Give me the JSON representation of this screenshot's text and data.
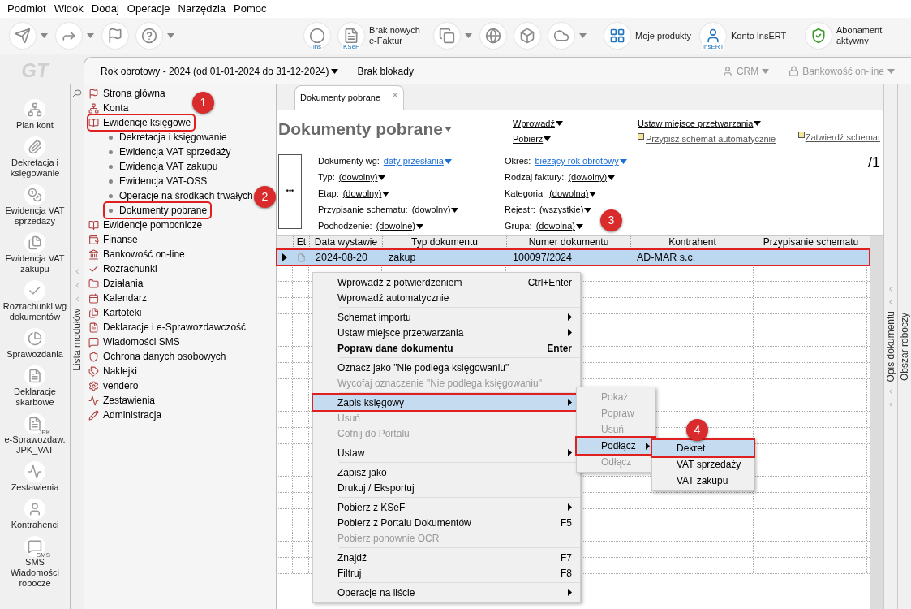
{
  "menu_bar": [
    "Podmiot",
    "Widok",
    "Dodaj",
    "Operacje",
    "Narzędzia",
    "Pomoc"
  ],
  "toolbar": [
    {
      "kind": "send",
      "has_menu": true
    },
    {
      "kind": "forward",
      "has_menu": true
    },
    {
      "kind": "flag",
      "has_menu": false
    },
    {
      "kind": "help",
      "has_menu": true
    },
    {
      "kind": "ins",
      "icon_text": "ins",
      "has_menu": false
    },
    {
      "kind": "ksef",
      "icon_text": "KSeF",
      "label": "Brak nowych e-Faktur",
      "has_menu": false
    },
    {
      "kind": "documents",
      "has_menu": true
    },
    {
      "kind": "globe",
      "has_menu": false
    },
    {
      "kind": "cube",
      "has_menu": false
    },
    {
      "kind": "cloud",
      "has_menu": true
    },
    {
      "kind": "products",
      "label": "Moje produkty",
      "has_menu": false
    },
    {
      "kind": "account",
      "icon_text": "InsERT",
      "label": "Konto InsERT",
      "has_menu": false
    },
    {
      "kind": "shield",
      "label": "Abonament aktywny",
      "has_menu": false
    }
  ],
  "logo": "GT",
  "header": {
    "year": "Rok obrotowy - 2024  (od 01-01-2024 do 31-12-2024)",
    "lock": "Brak blokady",
    "crm": "CRM",
    "banking": "Bankowość on-line"
  },
  "shortcuts": [
    {
      "kind": "accounts",
      "label": "Plan kont"
    },
    {
      "kind": "posting",
      "label": "Dekretacja i księgowanie"
    },
    {
      "kind": "coins",
      "label": "Ewidencja VAT sprzedaży"
    },
    {
      "kind": "files",
      "label": "Ewidencja VAT zakupu"
    },
    {
      "kind": "check",
      "label": "Rozrachunki wg dokumentów"
    },
    {
      "kind": "chart",
      "label": "Sprawozdania"
    },
    {
      "kind": "pages",
      "label": "Deklaracje skarbowe"
    },
    {
      "kind": "pages",
      "icon_text": "JPK",
      "label": "e-Sprawozdaw. JPK_VAT"
    },
    {
      "kind": "trend",
      "label": "Zestawienia"
    },
    {
      "kind": "person",
      "label": "Kontrahenci"
    },
    {
      "kind": "sms",
      "icon_text": "SMS",
      "label": "SMS Wiadomości robocze"
    }
  ],
  "modules_tab": "Lista modułów",
  "module_tree": [
    {
      "kind": "flag",
      "label": "Strona główna",
      "highlighted": false
    },
    {
      "kind": "network",
      "label": "Konta",
      "highlighted": false
    },
    {
      "kind": "book",
      "label": "Ewidencje księgowe",
      "highlighted": true,
      "children": [
        {
          "label": "Dekretacja i księgowanie",
          "highlighted": false
        },
        {
          "label": "Ewidencja VAT sprzedaży",
          "highlighted": false
        },
        {
          "label": "Ewidencja VAT zakupu",
          "highlighted": false
        },
        {
          "label": "Ewidencja VAT-OSS",
          "highlighted": false
        },
        {
          "label": "Operacje na środkach trwałych",
          "highlighted": false
        },
        {
          "label": "Dokumenty pobrane",
          "highlighted": true
        }
      ]
    },
    {
      "kind": "book",
      "label": "Ewidencje pomocnicze",
      "highlighted": false
    },
    {
      "kind": "wallet",
      "label": "Finanse",
      "highlighted": false
    },
    {
      "kind": "bank",
      "label": "Bankowość on-line",
      "highlighted": false
    },
    {
      "kind": "check",
      "label": "Rozrachunki",
      "highlighted": false
    },
    {
      "kind": "folder",
      "label": "Działania",
      "highlighted": false
    },
    {
      "kind": "calendar",
      "label": "Kalendarz",
      "highlighted": false
    },
    {
      "kind": "files",
      "label": "Kartoteki",
      "highlighted": false
    },
    {
      "kind": "pages",
      "label": "Deklaracje i e-Sprawozdawczość",
      "highlighted": false
    },
    {
      "kind": "message",
      "label": "Wiadomości SMS",
      "highlighted": false
    },
    {
      "kind": "shield",
      "label": "Ochrona danych osobowych",
      "highlighted": false
    },
    {
      "kind": "tags",
      "label": "Naklejki",
      "highlighted": false
    },
    {
      "kind": "gear",
      "label": "vendero",
      "highlighted": false
    },
    {
      "kind": "trend",
      "label": "Zestawienia",
      "highlighted": false
    },
    {
      "kind": "pencil",
      "label": "Administracja",
      "highlighted": false
    }
  ],
  "document_tab": {
    "label": "Dokumenty pobrane",
    "close": "×"
  },
  "title": "Dokumenty pobrane",
  "actions": [
    {
      "label": "Wprowadź",
      "kind": "dropdown"
    },
    {
      "label": "Pobierz",
      "kind": "dropdown"
    }
  ],
  "actions_2": [
    {
      "label": "Ustaw miejsce przetwarzania",
      "kind": "dropdown"
    },
    {
      "label": "Przypisz schemat automatycznie",
      "kind": "flagged"
    }
  ],
  "confirm_action": {
    "label": "Zatwierdź schemat"
  },
  "more_button": "•••",
  "filters_left": [
    {
      "label": "Dokumenty wg:",
      "value": "daty przesłania",
      "kind": "link"
    },
    {
      "label": "Typ:",
      "value": "(dowolny)",
      "kind": "choice"
    },
    {
      "label": "Etap:",
      "value": "(dowolny)",
      "kind": "choice"
    },
    {
      "label": "Przypisanie schematu:",
      "value": "(dowolny)",
      "kind": "choice"
    },
    {
      "label": "Pochodzenie:",
      "value": "(dowolne)",
      "kind": "choice"
    }
  ],
  "filters_right": [
    {
      "label": "Okres:",
      "value": "bieżący rok obrotowy",
      "kind": "link"
    },
    {
      "label": "Rodzaj faktury:",
      "value": "(dowolny)",
      "kind": "choice"
    },
    {
      "label": "Kategoria:",
      "value": "(dowolna)",
      "kind": "choice"
    },
    {
      "label": "Rejestr:",
      "value": "(wszystkie)",
      "kind": "choice"
    },
    {
      "label": "Grupa:",
      "value": "(dowolna)",
      "kind": "choice"
    }
  ],
  "page_count": "/1",
  "table": {
    "columns": [
      "Et",
      "Data wystawie",
      "Typ dokumentu",
      "Numer dokumentu",
      "Kontrahent",
      "Przypisanie schematu"
    ],
    "rows": [
      {
        "cells": [
          "",
          "2024-08-20",
          "zakup",
          "100097/2024",
          "AD-MAR s.c.",
          ""
        ],
        "selected": true,
        "highlighted": true
      }
    ]
  },
  "context_menu": [
    {
      "kind": "item",
      "label": "Wprowadź z potwierdzeniem",
      "shortcut": "Ctrl+Enter",
      "disabled": false,
      "bold": false,
      "submenu": false,
      "highlighted": false
    },
    {
      "kind": "item",
      "label": "Wprowadź automatycznie",
      "disabled": false,
      "bold": false,
      "submenu": false,
      "highlighted": false
    },
    {
      "kind": "separator"
    },
    {
      "kind": "item",
      "label": "Schemat importu",
      "disabled": false,
      "bold": false,
      "submenu": true,
      "highlighted": false
    },
    {
      "kind": "item",
      "label": "Ustaw miejsce przetwarzania",
      "disabled": false,
      "bold": false,
      "submenu": true,
      "highlighted": false
    },
    {
      "kind": "item",
      "label": "Popraw dane dokumentu",
      "shortcut": "Enter",
      "disabled": false,
      "bold": true,
      "submenu": false,
      "highlighted": false
    },
    {
      "kind": "separator"
    },
    {
      "kind": "item",
      "label": "Oznacz jako \"Nie podlega księgowaniu\"",
      "disabled": false,
      "bold": false,
      "submenu": false,
      "highlighted": false
    },
    {
      "kind": "item",
      "label": "Wycofaj oznaczenie \"Nie podlega księgowaniu\"",
      "disabled": true,
      "bold": false,
      "submenu": false,
      "highlighted": false
    },
    {
      "kind": "separator"
    },
    {
      "kind": "item",
      "label": "Zapis księgowy",
      "disabled": false,
      "bold": false,
      "submenu": true,
      "highlighted": true
    },
    {
      "kind": "item",
      "label": "Usuń",
      "disabled": true,
      "bold": false,
      "submenu": false,
      "highlighted": false
    },
    {
      "kind": "item",
      "label": "Cofnij do Portalu",
      "disabled": true,
      "bold": false,
      "submenu": false,
      "highlighted": false
    },
    {
      "kind": "separator"
    },
    {
      "kind": "item",
      "label": "Ustaw",
      "disabled": false,
      "bold": false,
      "submenu": true,
      "highlighted": false
    },
    {
      "kind": "separator"
    },
    {
      "kind": "item",
      "label": "Zapisz jako",
      "disabled": false,
      "bold": false,
      "submenu": false,
      "highlighted": false
    },
    {
      "kind": "item",
      "label": "Drukuj / Eksportuj",
      "disabled": false,
      "bold": false,
      "submenu": false,
      "highlighted": false
    },
    {
      "kind": "separator"
    },
    {
      "kind": "item",
      "label": "Pobierz z KSeF",
      "disabled": false,
      "bold": false,
      "submenu": true,
      "highlighted": false
    },
    {
      "kind": "item",
      "label": "Pobierz z Portalu Dokumentów",
      "shortcut": "F5",
      "disabled": false,
      "bold": false,
      "submenu": false,
      "highlighted": false
    },
    {
      "kind": "item",
      "label": "Pobierz ponownie OCR",
      "disabled": true,
      "bold": false,
      "submenu": false,
      "highlighted": false
    },
    {
      "kind": "separator"
    },
    {
      "kind": "item",
      "label": "Znajdź",
      "shortcut": "F7",
      "disabled": false,
      "bold": false,
      "submenu": false,
      "highlighted": false
    },
    {
      "kind": "item",
      "label": "Filtruj",
      "shortcut": "F8",
      "disabled": false,
      "bold": false,
      "submenu": false,
      "highlighted": false
    },
    {
      "kind": "separator"
    },
    {
      "kind": "item",
      "label": "Operacje na liście",
      "disabled": false,
      "bold": false,
      "submenu": true,
      "highlighted": false
    }
  ],
  "submenu": [
    {
      "label": "Pokaż",
      "disabled": true,
      "submenu": false,
      "highlighted": false
    },
    {
      "label": "Popraw",
      "disabled": true,
      "submenu": false,
      "highlighted": false
    },
    {
      "label": "Usuń",
      "disabled": true,
      "submenu": false,
      "highlighted": false
    },
    {
      "label": "Podłącz",
      "disabled": false,
      "submenu": true,
      "highlighted": true
    },
    {
      "label": "Odłącz",
      "disabled": true,
      "submenu": false,
      "highlighted": false
    }
  ],
  "submenu_2": [
    {
      "label": "Dekret",
      "disabled": false,
      "highlighted": true
    },
    {
      "label": "VAT sprzedaży",
      "disabled": false,
      "highlighted": false
    },
    {
      "label": "VAT zakupu",
      "disabled": false,
      "highlighted": false
    }
  ],
  "side_tabs": [
    "Opis dokumentu",
    "Obszar roboczy"
  ],
  "step_badges": [
    "1",
    "2",
    "3",
    "4"
  ]
}
